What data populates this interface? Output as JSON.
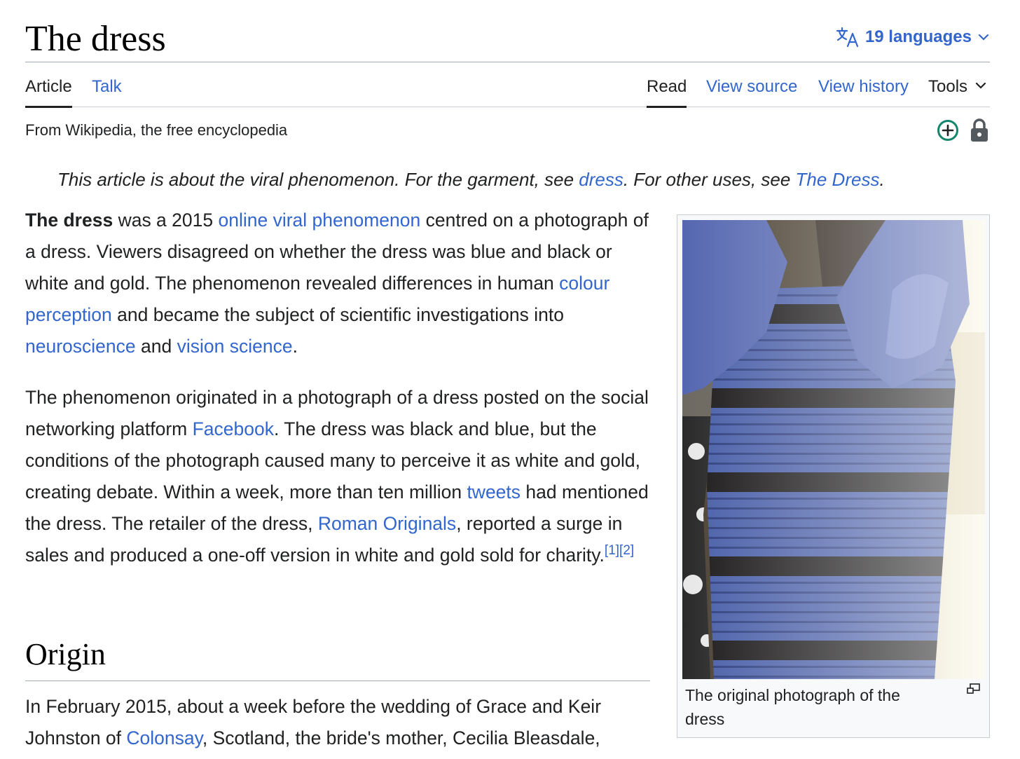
{
  "header": {
    "title": "The dress",
    "languages_label": "19 languages"
  },
  "tabs": {
    "article": "Article",
    "talk": "Talk",
    "read": "Read",
    "view_source": "View source",
    "view_history": "View history",
    "tools": "Tools"
  },
  "tagline": "From Wikipedia, the free encyclopedia",
  "hatnote": {
    "part1": "This article is about the viral phenomenon. For the garment, see ",
    "link1": "dress",
    "part2": ". For other uses, see ",
    "link2": "The Dress",
    "part3": "."
  },
  "lead": {
    "p1": {
      "bold": "The dress",
      "t1": " was a 2015 ",
      "l1": "online viral phenomenon",
      "t2": " centred on a photograph of a dress. Viewers disagreed on whether the dress was blue and black or white and gold. The phenomenon revealed differences in human ",
      "l2": "colour perception",
      "t3": " and became the subject of scientific investigations into ",
      "l3": "neuroscience",
      "t4": " and ",
      "l4": "vision science",
      "t5": "."
    },
    "p2": {
      "t1": "The phenomenon originated in a photograph of a dress posted on the social networking platform ",
      "l1": "Facebook",
      "t2": ". The dress was black and blue, but the conditions of the photograph caused many to perceive it as white and gold, creating debate. Within a week, more than ten million ",
      "l2": "tweets",
      "t3": " had mentioned the dress. The retailer of the dress, ",
      "l3": "Roman Originals",
      "t4": ", reported a surge in sales and produced a one-off version in white and gold sold for charity.",
      "ref1": "[1]",
      "ref2": "[2]"
    }
  },
  "origin": {
    "heading": "Origin",
    "t1": "In February 2015, about a week before the wedding of Grace and Keir Johnston of ",
    "l1": "Colonsay",
    "t2": ", Scotland, the bride's mother, Cecilia Bleasdale,"
  },
  "figure": {
    "caption": "The original photograph of the dress"
  },
  "icons": {
    "language": "translate-icon",
    "dropdown": "chevron-down-icon",
    "good_article": "plus-circle-icon",
    "protection": "lock-icon",
    "enlarge": "magnify-icon"
  },
  "colors": {
    "link": "#3366cc",
    "text": "#202122",
    "dress_blue": "#4a5fa8",
    "lace_black": "#1c1a1a",
    "good_article_green": "#14866d"
  }
}
